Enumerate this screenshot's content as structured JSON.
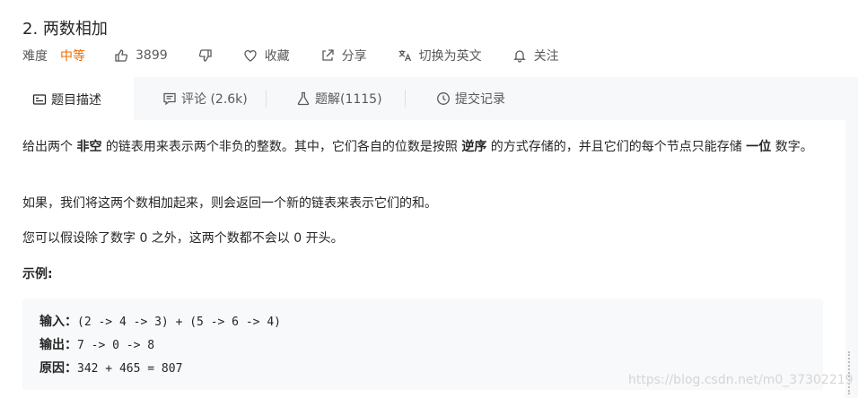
{
  "problem": {
    "title": "2. 两数相加",
    "difficulty_label": "难度",
    "difficulty_value": "中等",
    "likes": "3899",
    "favorite_label": "收藏",
    "share_label": "分享",
    "translate_label": "切换为英文",
    "follow_label": "关注"
  },
  "tabs": [
    {
      "label": "题目描述"
    },
    {
      "label": "评论 (2.6k)"
    },
    {
      "label": "题解(1115)"
    },
    {
      "label": "提交记录"
    }
  ],
  "description": {
    "p1_a": "给出两个 ",
    "p1_b": "非空",
    "p1_c": " 的链表用来表示两个非负的整数。其中，它们各自的位数是按照 ",
    "p1_d": "逆序",
    "p1_e": " 的方式存储的，并且它们的每个节点只能存储 ",
    "p1_f": "一位",
    "p1_g": " 数字。",
    "p2": "如果，我们将这两个数相加起来，则会返回一个新的链表来表示它们的和。",
    "p3": "您可以假设除了数字 0 之外，这两个数都不会以 0 开头。",
    "example_title": "示例:"
  },
  "example": {
    "input_label": "输入：",
    "input_value": "(2 -> 4 -> 3) + (5 -> 6 -> 4)",
    "output_label": "输出：",
    "output_value": "7 -> 0 -> 8",
    "reason_label": "原因：",
    "reason_value": "342 + 465 = 807"
  },
  "watermark": "https://blog.csdn.net/m0_37302219",
  "colors": {
    "difficulty": "#ef6c00",
    "text": "#262626",
    "muted": "#595959"
  }
}
